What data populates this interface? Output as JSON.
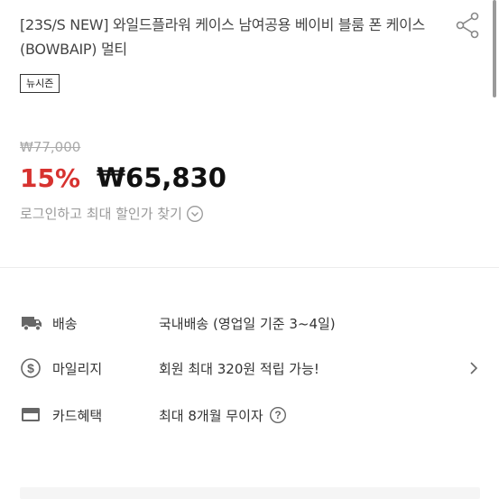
{
  "product": {
    "title": "[23S/S NEW] 와일드플라워 케이스 남여공용 베이비 블룸 폰 케이스(BOWBAIP) 멀티",
    "badge": "뉴시즌"
  },
  "price": {
    "original": "₩77,000",
    "discount": "15%",
    "sale": "₩65,830",
    "login_discount": "로그인하고 최대 할인가 찾기"
  },
  "info": {
    "shipping": {
      "label": "배송",
      "value": "국내배송 (영업일 기준 3~4일)"
    },
    "mileage": {
      "label": "마일리지",
      "value": "회원 최대 320원 적립 가능!"
    },
    "card": {
      "label": "카드혜택",
      "value": "최대 8개월 무이자"
    }
  },
  "icons": [
    "share-icon",
    "truck-icon",
    "dollar-coin-icon",
    "credit-card-icon",
    "chevron-down-icon",
    "chevron-right-icon",
    "help-icon"
  ],
  "colors": {
    "discount": "#d7322f",
    "text": "#222222",
    "muted": "#999999"
  }
}
